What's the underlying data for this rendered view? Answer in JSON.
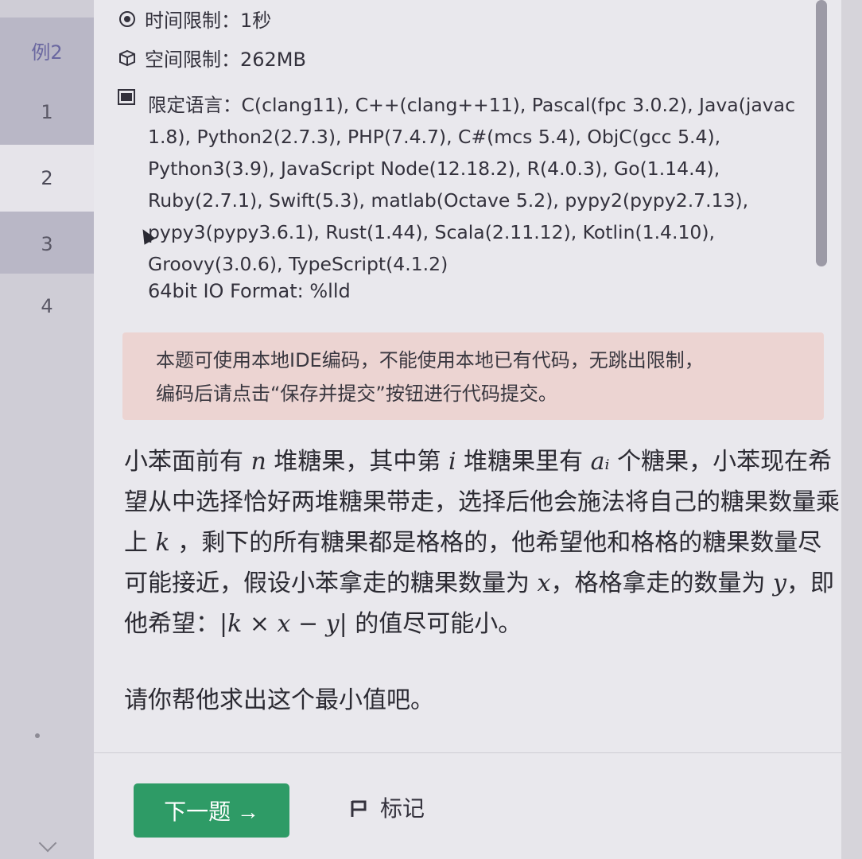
{
  "sidebar": {
    "items": [
      {
        "label": "例2"
      },
      {
        "label": "1"
      },
      {
        "label": "2"
      },
      {
        "label": "3"
      },
      {
        "label": "4"
      }
    ]
  },
  "meta": {
    "time_limit": "时间限制：1秒",
    "memory_limit": "空间限制：262MB",
    "lang_label": "限定语言：",
    "languages": "C(clang11), C++(clang++11), Pascal(fpc 3.0.2), Java(javac 1.8), Python2(2.7.3), PHP(7.4.7), C#(mcs 5.4), ObjC(gcc 5.4), Python3(3.9), JavaScript Node(12.18.2), R(4.0.3), Go(1.14.4), Ruby(2.7.1), Swift(5.3), matlab(Octave 5.2), pypy2(pypy2.7.13), pypy3(pypy3.6.1), Rust(1.44), Scala(2.11.12), Kotlin(1.4.10), Groovy(3.0.6), TypeScript(4.1.2)",
    "io_format": "64bit IO Format: %lld"
  },
  "notice": {
    "line1": "本题可使用本地IDE编码，不能使用本地已有代码，无跳出限制，",
    "line2": "编码后请点击“保存并提交”按钮进行代码提交。"
  },
  "statement": {
    "p1_a": "小苯面前有 ",
    "var_n": "n",
    "p1_b": " 堆糖果，其中第 ",
    "var_i": "i",
    "p1_c": " 堆糖果里有 ",
    "var_ai": "aᵢ",
    "p1_d": " 个糖果，小苯现在希望从中选择恰好两堆糖果带走，选择后他会施法将自己的糖果数量乘上 ",
    "var_k": "k",
    "p1_e": " ，剩下的所有糖果都是格格的，他希望他和格格的糖果数量尽可能接近，假设小苯拿走的糖果数量为 ",
    "var_x": "x",
    "p1_f": "，格格拿走的数量为 ",
    "var_y": "y",
    "p1_g": "，即他希望：",
    "formula": "|k × x − y|",
    "p1_h": " 的值尽可能小。",
    "ask": "请你帮他求出这个最小值吧。"
  },
  "footer": {
    "next_label": "下一题 →",
    "mark_label": "标记"
  },
  "colors": {
    "accent_green": "#2e9b66",
    "notice_bg": "#ecd4d2"
  }
}
